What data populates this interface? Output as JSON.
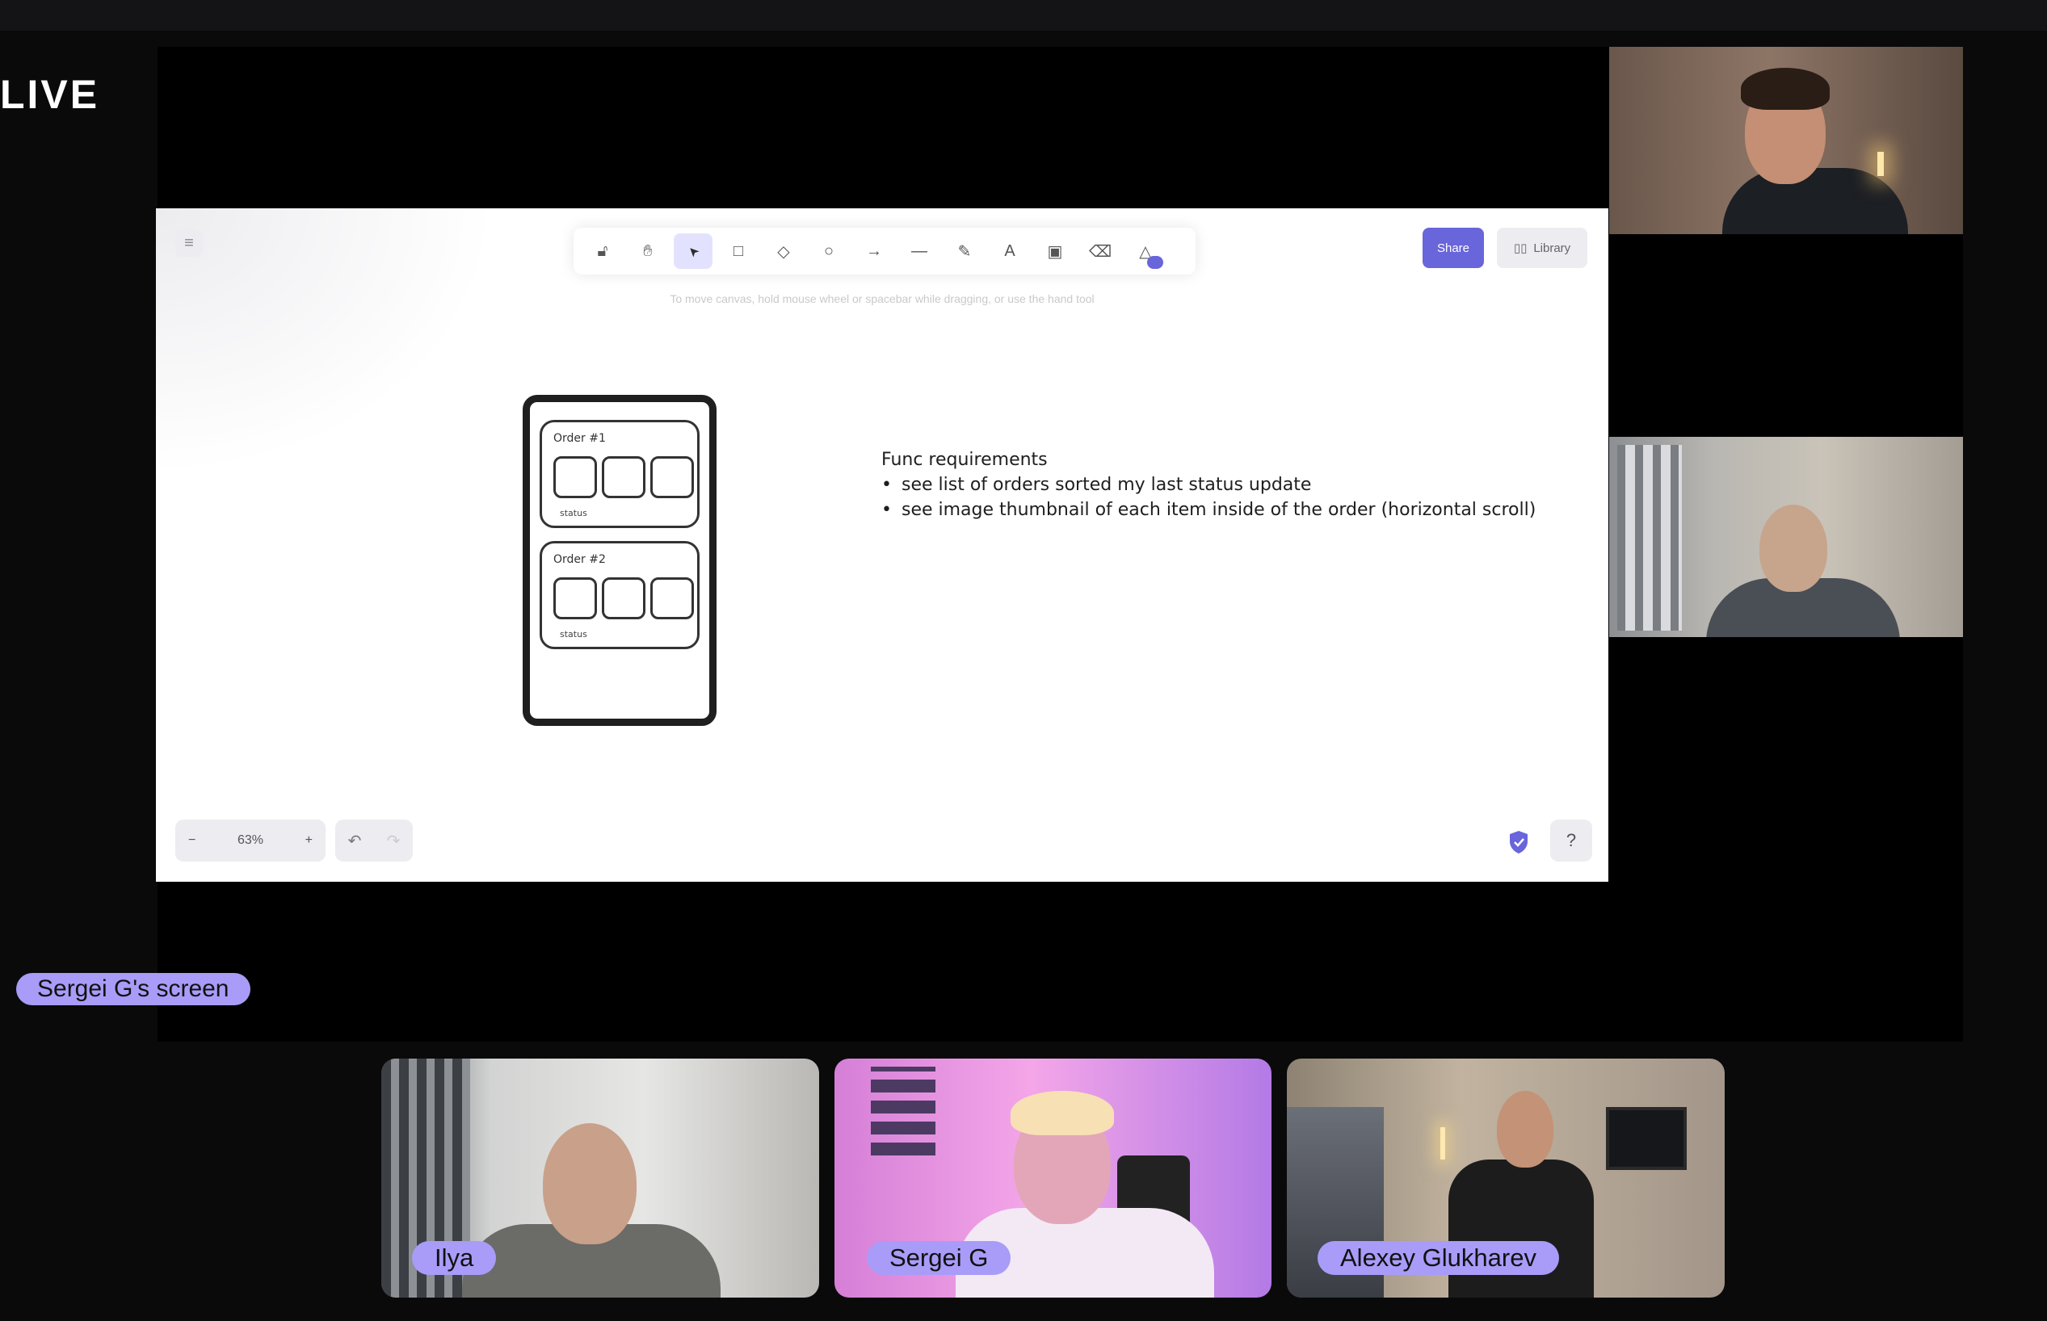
{
  "header": {
    "live_label": "LIVE"
  },
  "shared_screen": {
    "label": "Sergei G's screen",
    "whiteboard": {
      "menu_icon": "hamburger-icon",
      "toolbar": {
        "tools": [
          {
            "name": "lock",
            "icon": "lock-icon",
            "glyph": "🔓︎"
          },
          {
            "name": "hand",
            "icon": "hand-icon",
            "glyph": "✋︎"
          },
          {
            "name": "selection",
            "icon": "pointer-icon",
            "glyph": "➤"
          },
          {
            "name": "rectangle",
            "icon": "rectangle-icon",
            "glyph": "□"
          },
          {
            "name": "diamond",
            "icon": "diamond-icon",
            "glyph": "◇"
          },
          {
            "name": "ellipse",
            "icon": "ellipse-icon",
            "glyph": "○"
          },
          {
            "name": "arrow",
            "icon": "arrow-icon",
            "glyph": "→"
          },
          {
            "name": "line",
            "icon": "line-icon",
            "glyph": "—"
          },
          {
            "name": "draw",
            "icon": "pencil-icon",
            "glyph": "✎"
          },
          {
            "name": "text",
            "icon": "text-icon",
            "glyph": "A"
          },
          {
            "name": "image",
            "icon": "image-icon",
            "glyph": "▣"
          },
          {
            "name": "eraser",
            "icon": "eraser-icon",
            "glyph": "⌫"
          },
          {
            "name": "more",
            "icon": "shapes-icon",
            "glyph": "△"
          }
        ],
        "active_tool": "selection"
      },
      "share_label": "Share",
      "library_label": "Library",
      "canvas_hint": "To move canvas, hold mouse wheel or spacebar while dragging, or use the hand tool",
      "orders": [
        {
          "title": "Order #1",
          "status": "status"
        },
        {
          "title": "Order #2",
          "status": "status"
        }
      ],
      "requirements": {
        "heading": "Func requirements",
        "items": [
          "see list of orders sorted my last status update",
          "see image thumbnail of each item inside of the order (horizontal scroll)"
        ]
      },
      "zoom": {
        "minus": "−",
        "value": "63%",
        "plus": "+"
      },
      "undo_glyph": "↶",
      "redo_glyph": "↷",
      "help_glyph": "?"
    }
  },
  "participants": [
    {
      "name": "Ilya"
    },
    {
      "name": "Sergei G"
    },
    {
      "name": "Alexey Glukharev"
    }
  ],
  "colors": {
    "accent": "#a89cf8",
    "whiteboard_primary": "#6965db",
    "background": "#000000"
  }
}
